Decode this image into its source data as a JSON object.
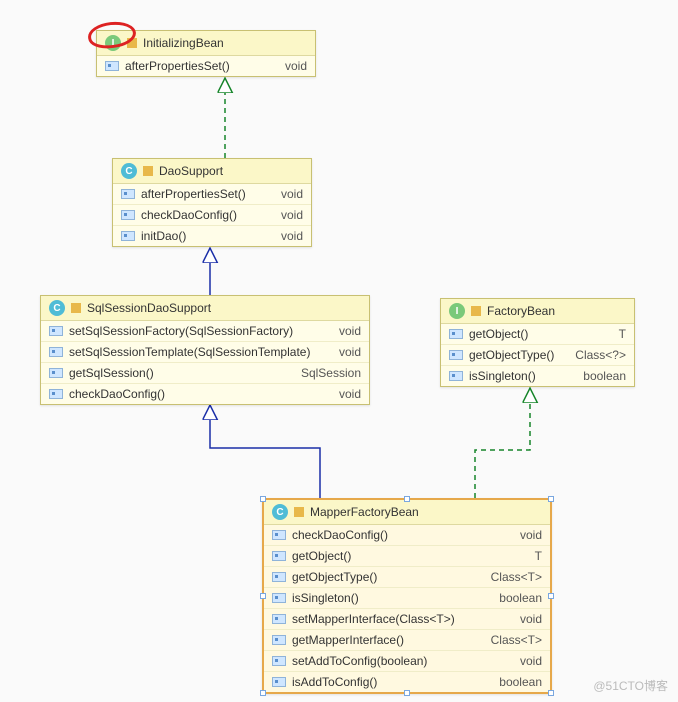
{
  "watermark": "@51CTO博客",
  "boxes": {
    "initBean": {
      "kind": "interface",
      "badge": "I",
      "title": "InitializingBean",
      "methods": [
        {
          "sig": "afterPropertiesSet()",
          "ret": "void"
        }
      ]
    },
    "daoSupport": {
      "kind": "class",
      "badge": "C",
      "title": "DaoSupport",
      "methods": [
        {
          "sig": "afterPropertiesSet()",
          "ret": "void"
        },
        {
          "sig": "checkDaoConfig()",
          "ret": "void"
        },
        {
          "sig": "initDao()",
          "ret": "void"
        }
      ]
    },
    "sqlSessionDao": {
      "kind": "class",
      "badge": "C",
      "title": "SqlSessionDaoSupport",
      "methods": [
        {
          "sig": "setSqlSessionFactory(SqlSessionFactory)",
          "ret": "void"
        },
        {
          "sig": "setSqlSessionTemplate(SqlSessionTemplate)",
          "ret": "void"
        },
        {
          "sig": "getSqlSession()",
          "ret": "SqlSession"
        },
        {
          "sig": "checkDaoConfig()",
          "ret": "void"
        }
      ]
    },
    "factoryBean": {
      "kind": "interface",
      "badge": "I",
      "title": "FactoryBean",
      "methods": [
        {
          "sig": "getObject()",
          "ret": "T"
        },
        {
          "sig": "getObjectType()",
          "ret": "Class<?>"
        },
        {
          "sig": "isSingleton()",
          "ret": "boolean"
        }
      ]
    },
    "mapperFactoryBean": {
      "kind": "class",
      "badge": "C",
      "title": "MapperFactoryBean",
      "methods": [
        {
          "sig": "checkDaoConfig()",
          "ret": "void"
        },
        {
          "sig": "getObject()",
          "ret": "T"
        },
        {
          "sig": "getObjectType()",
          "ret": "Class<T>"
        },
        {
          "sig": "isSingleton()",
          "ret": "boolean"
        },
        {
          "sig": "setMapperInterface(Class<T>)",
          "ret": "void"
        },
        {
          "sig": "getMapperInterface()",
          "ret": "Class<T>"
        },
        {
          "sig": "setAddToConfig(boolean)",
          "ret": "void"
        },
        {
          "sig": "isAddToConfig()",
          "ret": "boolean"
        }
      ]
    }
  },
  "chart_data": {
    "type": "uml_class_diagram",
    "nodes": [
      {
        "id": "InitializingBean",
        "stereotype": "interface",
        "methods": [
          "afterPropertiesSet(): void"
        ]
      },
      {
        "id": "DaoSupport",
        "stereotype": "class",
        "methods": [
          "afterPropertiesSet(): void",
          "checkDaoConfig(): void",
          "initDao(): void"
        ]
      },
      {
        "id": "SqlSessionDaoSupport",
        "stereotype": "class",
        "methods": [
          "setSqlSessionFactory(SqlSessionFactory): void",
          "setSqlSessionTemplate(SqlSessionTemplate): void",
          "getSqlSession(): SqlSession",
          "checkDaoConfig(): void"
        ]
      },
      {
        "id": "FactoryBean",
        "stereotype": "interface",
        "methods": [
          "getObject(): T",
          "getObjectType(): Class<?>",
          "isSingleton(): boolean"
        ]
      },
      {
        "id": "MapperFactoryBean",
        "stereotype": "class",
        "methods": [
          "checkDaoConfig(): void",
          "getObject(): T",
          "getObjectType(): Class<T>",
          "isSingleton(): boolean",
          "setMapperInterface(Class<T>): void",
          "getMapperInterface(): Class<T>",
          "setAddToConfig(boolean): void",
          "isAddToConfig(): boolean"
        ]
      }
    ],
    "edges": [
      {
        "from": "DaoSupport",
        "to": "InitializingBean",
        "rel": "realization"
      },
      {
        "from": "SqlSessionDaoSupport",
        "to": "DaoSupport",
        "rel": "generalization"
      },
      {
        "from": "MapperFactoryBean",
        "to": "SqlSessionDaoSupport",
        "rel": "generalization"
      },
      {
        "from": "MapperFactoryBean",
        "to": "FactoryBean",
        "rel": "realization"
      }
    ],
    "annotations": [
      {
        "type": "red_circle_highlight",
        "around": "InitializingBean interface badge"
      }
    ]
  }
}
